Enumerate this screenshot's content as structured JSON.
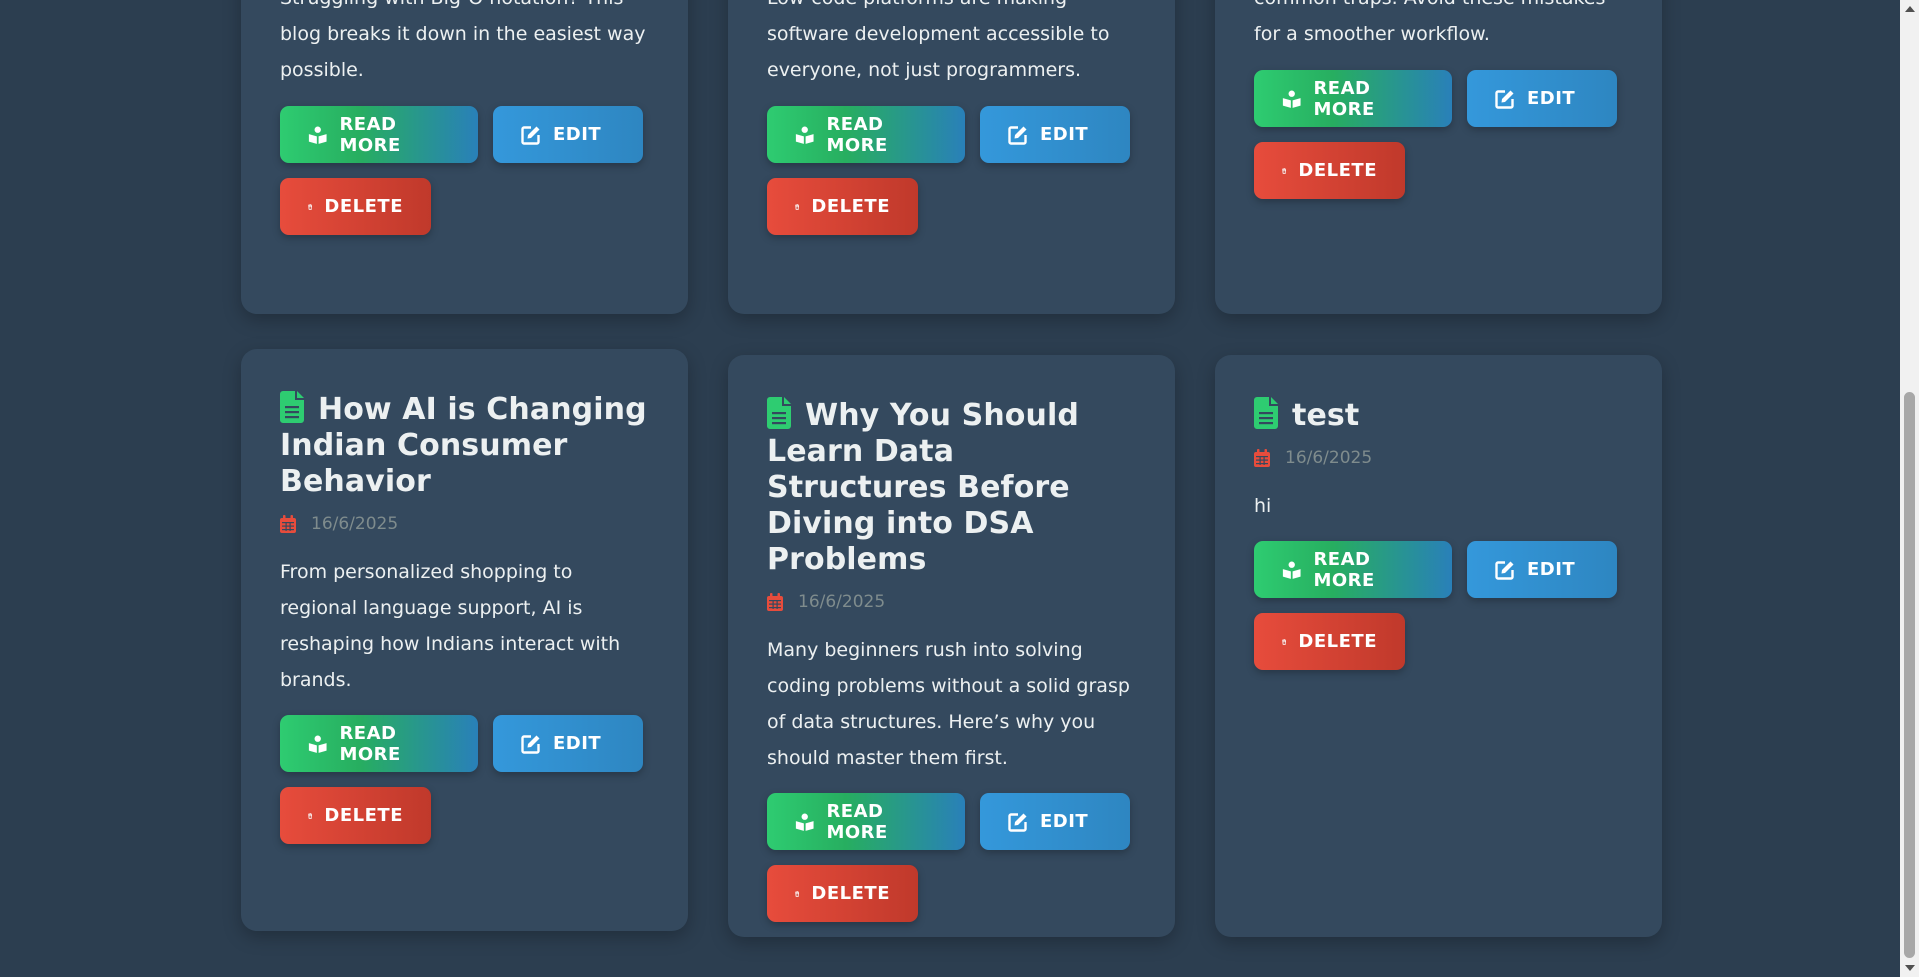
{
  "buttons": {
    "read_more": "READ MORE",
    "edit": "EDIT",
    "delete": "DELETE"
  },
  "top_row": [
    {
      "excerpt": "Struggling with Big-O notation? This blog breaks it down in the easiest way possible."
    },
    {
      "excerpt": "Low-code platforms are making software development accessible to everyone, not just programmers."
    },
    {
      "excerpt": "common traps. Avoid these mistakes for a smoother workflow."
    }
  ],
  "cards": [
    {
      "title": "How AI is Changing Indian Consumer Behavior",
      "date": "16/6/2025",
      "excerpt": "From personalized shopping to regional language support, AI is reshaping how Indians interact with brands."
    },
    {
      "title": "Why You Should Learn Data Structures Before Diving into DSA Problems",
      "date": "16/6/2025",
      "excerpt": "Many beginners rush into solving coding problems without a solid grasp of data structures. Here’s why you should master them first."
    },
    {
      "title": "test",
      "date": "16/6/2025",
      "excerpt": "hi"
    }
  ],
  "colors": {
    "background": "#2c3e50",
    "card": "#34495e",
    "accent_green": "#2ecc71",
    "accent_blue": "#3498db",
    "accent_red": "#e74c3c",
    "date_gray": "#7f8c8d"
  },
  "icons": {
    "title": "file-text-icon",
    "date": "calendar-icon",
    "read_more": "book-reader-icon",
    "edit": "edit-icon",
    "delete": "trash-icon"
  }
}
